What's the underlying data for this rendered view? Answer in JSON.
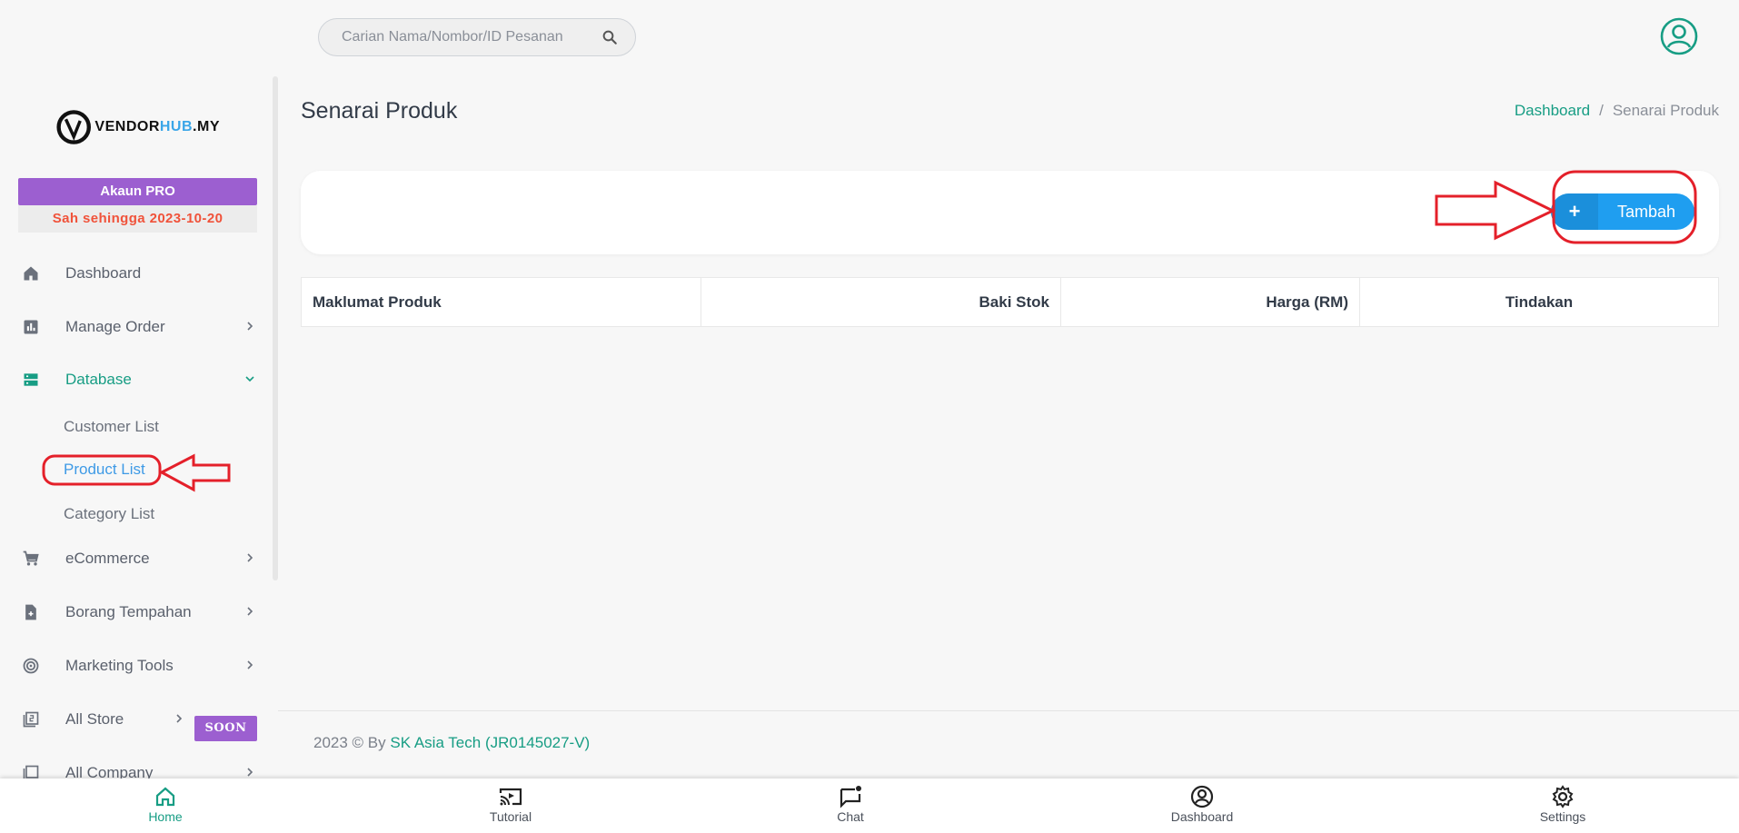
{
  "header": {
    "search_placeholder": "Carian Nama/Nombor/ID Pesanan",
    "search_icon": "search-icon",
    "profile_icon": "account-circle-icon"
  },
  "sidebar": {
    "logo_prefix": "VENDOR",
    "logo_hub": "HUB",
    "logo_suffix": ".MY",
    "pro_title": "Akaun PRO",
    "pro_valid": "Sah sehingga 2023-10-20",
    "items": [
      {
        "label": "Dashboard",
        "icon": "home-icon"
      },
      {
        "label": "Manage Order",
        "icon": "chart-icon"
      },
      {
        "label": "Database",
        "icon": "database-icon"
      },
      {
        "label": "eCommerce",
        "icon": "cart-icon"
      },
      {
        "label": "Borang Tempahan",
        "icon": "form-icon"
      },
      {
        "label": "Marketing Tools",
        "icon": "target-icon"
      },
      {
        "label": "All Store",
        "icon": "store-list-icon"
      },
      {
        "label": "All Company",
        "icon": "company-list-icon"
      }
    ],
    "sub_items": [
      {
        "label": "Customer List"
      },
      {
        "label": "Product List"
      },
      {
        "label": "Category List"
      }
    ],
    "soon_badge": "SOON"
  },
  "main": {
    "title": "Senarai Produk",
    "breadcrumb": {
      "link": "Dashboard",
      "separator": "/",
      "current": "Senarai Produk"
    },
    "add_button": {
      "icon": "+",
      "label": "Tambah"
    },
    "table": {
      "headers": [
        "Maklumat Produk",
        "Baki Stok",
        "Harga (RM)",
        "Tindakan"
      ]
    }
  },
  "footer": {
    "prefix": "2023 © By ",
    "company": "SK Asia Tech (JR0145027-V)"
  },
  "bottom_nav": [
    {
      "label": "Home",
      "icon": "home-icon"
    },
    {
      "label": "Tutorial",
      "icon": "cast-icon"
    },
    {
      "label": "Chat",
      "icon": "chat-icon"
    },
    {
      "label": "Dashboard",
      "icon": "account-circle-icon"
    },
    {
      "label": "Settings",
      "icon": "gear-icon"
    }
  ],
  "colors": {
    "accent": "#179d84",
    "primary_button": "#1f9ef0",
    "pro_badge": "#9c5fd0",
    "expiry_text": "#f0523a",
    "annotation": "#e4202a"
  }
}
